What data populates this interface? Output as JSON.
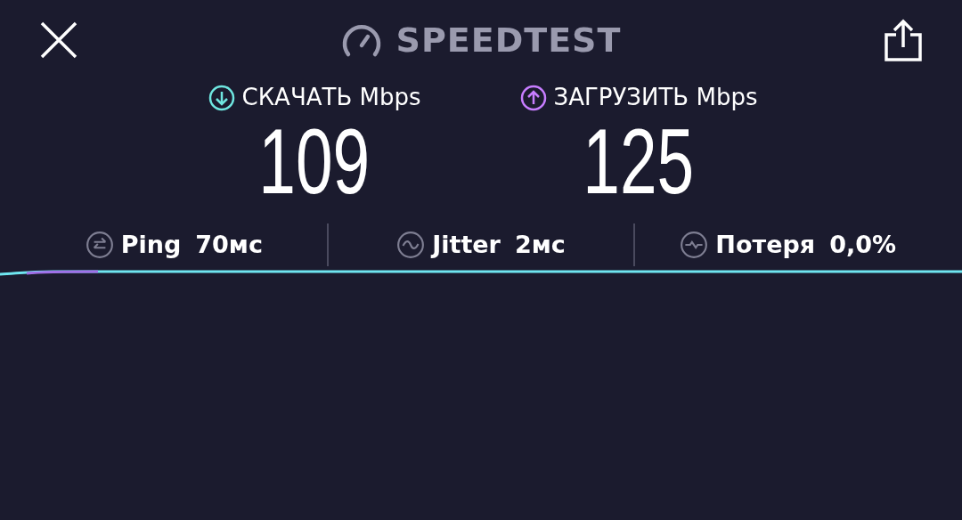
{
  "header": {
    "title": "SPEEDTEST"
  },
  "metrics": [
    {
      "kind": "download",
      "label": "СКАЧАТЬ",
      "unit": "Mbps",
      "value": "109"
    },
    {
      "kind": "upload",
      "label": "ЗАГРУЗИТЬ",
      "unit": "Mbps",
      "value": "125"
    }
  ],
  "stats": [
    {
      "kind": "ping",
      "label": "Ping",
      "value": "70мс"
    },
    {
      "kind": "jitter",
      "label": "Jitter",
      "value": "2мс"
    },
    {
      "kind": "loss",
      "label": "Потеря",
      "value": "0,0%"
    }
  ]
}
